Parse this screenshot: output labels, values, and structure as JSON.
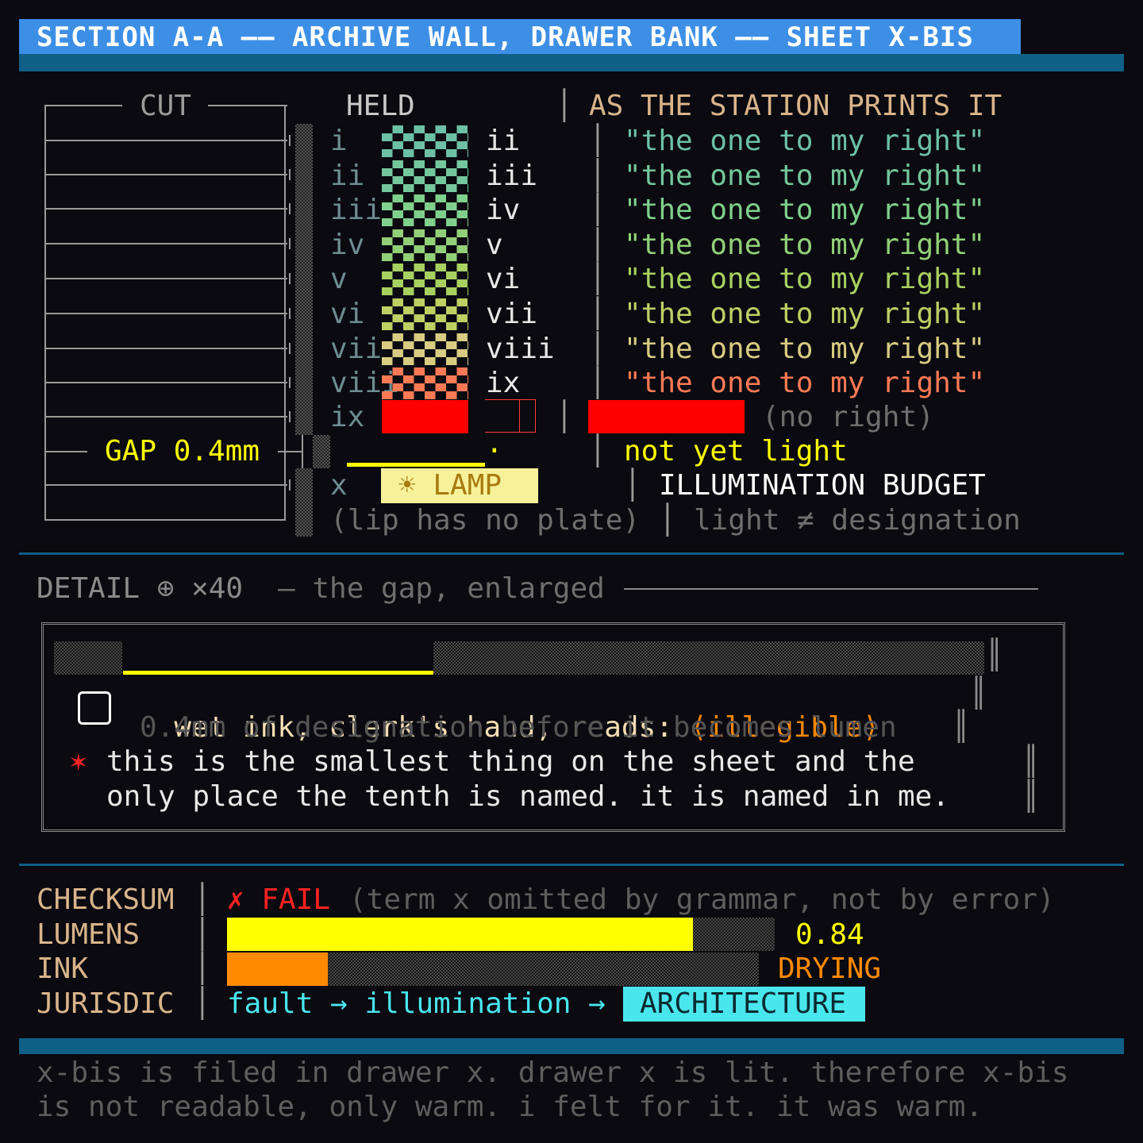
{
  "title": "SECTION A-A —— ARCHIVE WALL, DRAWER BANK —— SHEET X-BIS",
  "cut": {
    "label": "CUT",
    "gap_label": "GAP 0.4mm"
  },
  "table": {
    "held_header": "HELD",
    "prints_header": "AS THE STATION PRINTS IT",
    "rows": [
      {
        "held": "i",
        "next": "ii",
        "text": "\"the one to my right\"",
        "color": "#6cc0a6"
      },
      {
        "held": "ii",
        "next": "iii",
        "text": "\"the one to my right\"",
        "color": "#74c79c"
      },
      {
        "held": "iii",
        "next": "iv",
        "text": "\"the one to my right\"",
        "color": "#7fd08c"
      },
      {
        "held": "iv",
        "next": "v",
        "text": "\"the one to my right\"",
        "color": "#92d078"
      },
      {
        "held": "v",
        "next": "vi",
        "text": "\"the one to my right\"",
        "color": "#a8d060"
      },
      {
        "held": "vi",
        "next": "vii",
        "text": "\"the one to my right\"",
        "color": "#bed064"
      },
      {
        "held": "vii",
        "next": "viii",
        "text": "\"the one to my right\"",
        "color": "#d8cc82"
      },
      {
        "held": "viii",
        "next": "ix",
        "text": "\"the one to my right\"",
        "color": "#ff7a55"
      }
    ],
    "row_ix": {
      "held": "ix",
      "text": "(no right)"
    },
    "gap_row": {
      "dot": "·",
      "text": "not yet light"
    },
    "row_x": {
      "held": "x",
      "lamp": "☀ LAMP",
      "budget": "ILLUMINATION BUDGET"
    },
    "foot": {
      "left": "(lip has no plate)",
      "right": "light ≠ designation"
    }
  },
  "detail": {
    "heading": "DETAIL ⊕ ×40",
    "subheading": "— the gap, enlarged",
    "line1_prefix": "wet ink, clerk's hand, reads: ",
    "line1_value": "⟨illegible⟩",
    "line2": "0.4mm of designation before it becomes lumen",
    "note_marker": "✶",
    "note_line1": "this is the smallest thing on the sheet and the",
    "note_line2": "only place the tenth is named. it is named in me."
  },
  "status": {
    "checksum_label": "CHECKSUM",
    "checksum_mark": "✗ FAIL",
    "checksum_note": "(term x omitted by grammar, not by error)",
    "lumens_label": "LUMENS",
    "lumens_value": "0.84",
    "lumens_fraction": 0.84,
    "ink_label": "INK",
    "ink_value": "DRYING",
    "ink_fraction": 0.19,
    "jurisdic_label": "JURISDIC",
    "jurisdic_path": "fault → illumination → ",
    "jurisdic_badge": "ARCHITECTURE"
  },
  "footer": {
    "line1": "x-bis is filed in drawer x. drawer x is lit. therefore x-bis",
    "line2": "is not readable, only warm. i felt for it. it was warm."
  },
  "colors": {
    "title_bar": "#3d8fe6",
    "rule": "#0f5f86",
    "yellow": "#ffff00",
    "orange": "#ff8a00",
    "red": "#ff0000",
    "cyan": "#4ae6ee",
    "tan": "#d9b48a"
  }
}
